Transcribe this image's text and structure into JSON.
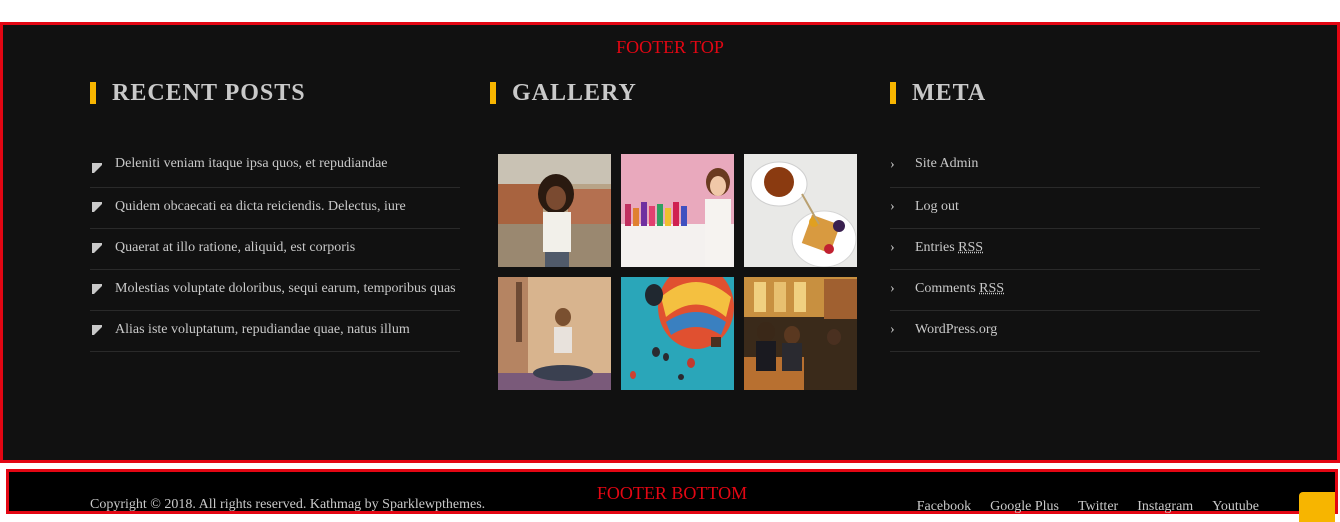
{
  "labels": {
    "footer_top": "FOOTER TOP",
    "footer_bottom": "FOOTER BOTTOM"
  },
  "recent_posts": {
    "title": "RECENT POSTS",
    "items": [
      "Deleniti veniam itaque ipsa quos, et repudiandae",
      "Quidem obcaecati ea dicta reiciendis. Delectus, iure",
      "Quaerat at illo ratione, aliquid, est corporis",
      "Molestias voluptate doloribus, sequi earum, temporibus quas",
      "Alias iste voluptatum, repudiandae quae, natus illum"
    ]
  },
  "gallery": {
    "title": "GALLERY",
    "images": [
      "woman-rooftop-photo",
      "cosmetics-shop-photo",
      "tea-and-waffles-photo",
      "yoga-meditation-photo",
      "hot-air-balloons-photo",
      "cafe-couple-photo"
    ]
  },
  "meta": {
    "title": "META",
    "items": [
      {
        "prefix": "Site Admin",
        "abbr": ""
      },
      {
        "prefix": "Log out",
        "abbr": ""
      },
      {
        "prefix": "Entries ",
        "abbr": "RSS"
      },
      {
        "prefix": "Comments ",
        "abbr": "RSS"
      },
      {
        "prefix": "WordPress.org",
        "abbr": ""
      }
    ]
  },
  "bottom": {
    "copyright": "Copyright © 2018. All rights reserved. Kathmag by Sparklewpthemes.",
    "social": [
      "Facebook",
      "Google Plus",
      "Twitter",
      "Instagram",
      "Youtube"
    ]
  },
  "colors": {
    "accent": "#f7b500",
    "annotation": "#e30613",
    "footer_bg": "#111111"
  }
}
